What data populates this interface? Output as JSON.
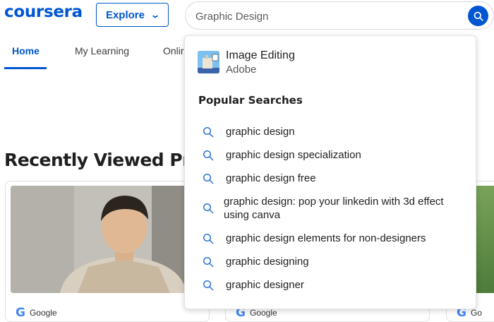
{
  "header": {
    "logo": "coursera",
    "explore_label": "Explore",
    "search_value": "Graphic Design"
  },
  "nav": {
    "tabs": [
      {
        "label": "Home"
      },
      {
        "label": "My Learning"
      },
      {
        "label": "Onlir"
      }
    ]
  },
  "section": {
    "title": "Recently Viewed Produ"
  },
  "cards": [
    {
      "partner": "Google"
    },
    {
      "partner": "Google"
    },
    {
      "partner": "Go"
    }
  ],
  "dropdown": {
    "recent": {
      "title": "Image Editing",
      "subtitle": "Adobe"
    },
    "popular_header": "Popular Searches",
    "suggestions": [
      "graphic design",
      "graphic design specialization",
      "graphic design free",
      "graphic design: pop your linkedin with 3d effect using canva",
      "graphic design elements for non-designers",
      "graphic designing",
      "graphic designer"
    ]
  },
  "colors": {
    "brand": "#0056d2",
    "google_blue": "#4285f4"
  },
  "icons": [
    "chevron-down-icon",
    "search-icon",
    "google-logo-icon"
  ]
}
